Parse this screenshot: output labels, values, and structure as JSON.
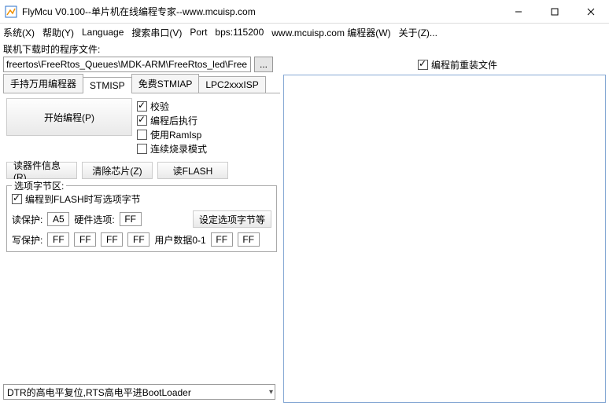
{
  "window": {
    "title": "FlyMcu V0.100--单片机在线编程专家--www.mcuisp.com"
  },
  "menu": {
    "system": "系统(X)",
    "help": "帮助(Y)",
    "language": "Language",
    "search_port": "搜索串口(V)",
    "port": "Port",
    "bps": "bps:115200",
    "site": "www.mcuisp.com 编程器(W)",
    "about": "关于(Z)..."
  },
  "file_label": "联机下载时的程序文件:",
  "file_path": "freertos\\FreeRtos_Queues\\MDK-ARM\\FreeRtos_led\\FreeRtos_led.hex",
  "browse_label": "...",
  "reinstall": {
    "checked": true,
    "label": "编程前重装文件"
  },
  "tabs": {
    "t1": "手持万用编程器",
    "t2": "STMISP",
    "t3": "免费STMIAP",
    "t4": "LPC2xxxISP",
    "active": "STMISP"
  },
  "program_btn": "开始编程(P)",
  "checks": {
    "verify": {
      "checked": true,
      "label": "校验"
    },
    "runafter": {
      "checked": true,
      "label": "编程后执行"
    },
    "ramisp": {
      "checked": false,
      "label": "使用RamIsp"
    },
    "contburn": {
      "checked": false,
      "label": "连续烧录模式"
    }
  },
  "buttons": {
    "readinfo": "读器件信息(R)",
    "erase": "清除芯片(Z)",
    "readflash": "读FLASH"
  },
  "optgroup": {
    "legend": "选项字节区:",
    "prog_option": {
      "checked": true,
      "label": "编程到FLASH时写选项字节"
    },
    "read_protect_label": "读保护:",
    "read_protect_value": "A5",
    "hw_label": "硬件选项:",
    "hw_value": "FF",
    "set_btn": "设定选项字节等",
    "write_protect_label": "写保护:",
    "wp": [
      "FF",
      "FF",
      "FF",
      "FF"
    ],
    "userdata_label": "用户数据0-1",
    "ud": [
      "FF",
      "FF"
    ]
  },
  "dtr_select": "DTR的高电平复位,RTS高电平进BootLoader"
}
